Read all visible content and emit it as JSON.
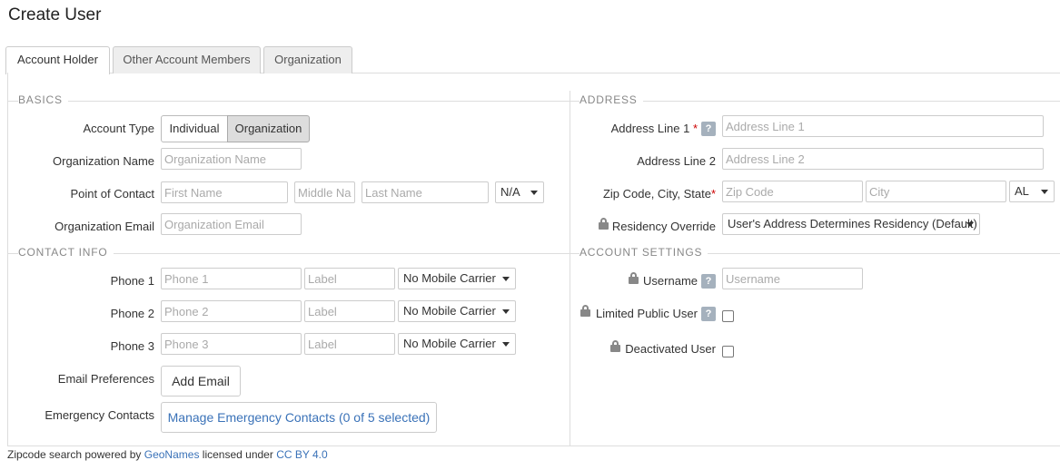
{
  "page": {
    "title": "Create User"
  },
  "tabs": [
    {
      "label": "Account Holder"
    },
    {
      "label": "Other Account Members"
    },
    {
      "label": "Organization"
    }
  ],
  "basics": {
    "heading": "BASICS",
    "account_type_label": "Account Type",
    "account_type_options": [
      "Individual",
      "Organization"
    ],
    "account_type_selected": "Organization",
    "org_name_label": "Organization Name",
    "org_name_placeholder": "Organization Name",
    "poc_label": "Point of Contact",
    "first_name_placeholder": "First Name",
    "middle_name_placeholder": "Middle Name",
    "last_name_placeholder": "Last Name",
    "suffix_value": "N/A",
    "org_email_label": "Organization Email",
    "org_email_placeholder": "Organization Email"
  },
  "contact": {
    "heading": "CONTACT INFO",
    "phones": [
      {
        "label": "Phone 1",
        "placeholder": "Phone 1",
        "label_placeholder": "Label",
        "carrier": "No Mobile Carrier"
      },
      {
        "label": "Phone 2",
        "placeholder": "Phone 2",
        "label_placeholder": "Label",
        "carrier": "No Mobile Carrier"
      },
      {
        "label": "Phone 3",
        "placeholder": "Phone 3",
        "label_placeholder": "Label",
        "carrier": "No Mobile Carrier"
      }
    ],
    "email_pref_label": "Email Preferences",
    "add_email_button": "Add Email",
    "emergency_label": "Emergency Contacts",
    "manage_emergency_button": "Manage Emergency Contacts (0 of 5 selected)"
  },
  "address": {
    "heading": "ADDRESS",
    "line1_label": "Address Line 1",
    "line1_placeholder": "Address Line 1",
    "line2_label": "Address Line 2",
    "line2_placeholder": "Address Line 2",
    "zip_label": "Zip Code, City, State",
    "zip_placeholder": "Zip Code",
    "city_placeholder": "City",
    "state_value": "AL",
    "residency_label": "Residency Override",
    "residency_value": "User's Address Determines Residency (Default)",
    "required_mark": "*",
    "help_glyph": "?"
  },
  "account_settings": {
    "heading": "ACCOUNT SETTINGS",
    "username_label": "Username",
    "username_placeholder": "Username",
    "limited_label": "Limited Public User",
    "limited_checked": false,
    "deactivated_label": "Deactivated User",
    "deactivated_checked": false
  },
  "footer": {
    "prefix": "Zipcode search powered by ",
    "geonames": "GeoNames",
    "middle": " licensed under ",
    "license": "CC BY 4.0"
  },
  "icons": {
    "lock": "lock-icon",
    "help": "help-icon",
    "caret": "caret-down-icon"
  },
  "colors": {
    "link": "#3a72b8",
    "required": "#cc0000",
    "help_bg": "#a5b1bd"
  }
}
